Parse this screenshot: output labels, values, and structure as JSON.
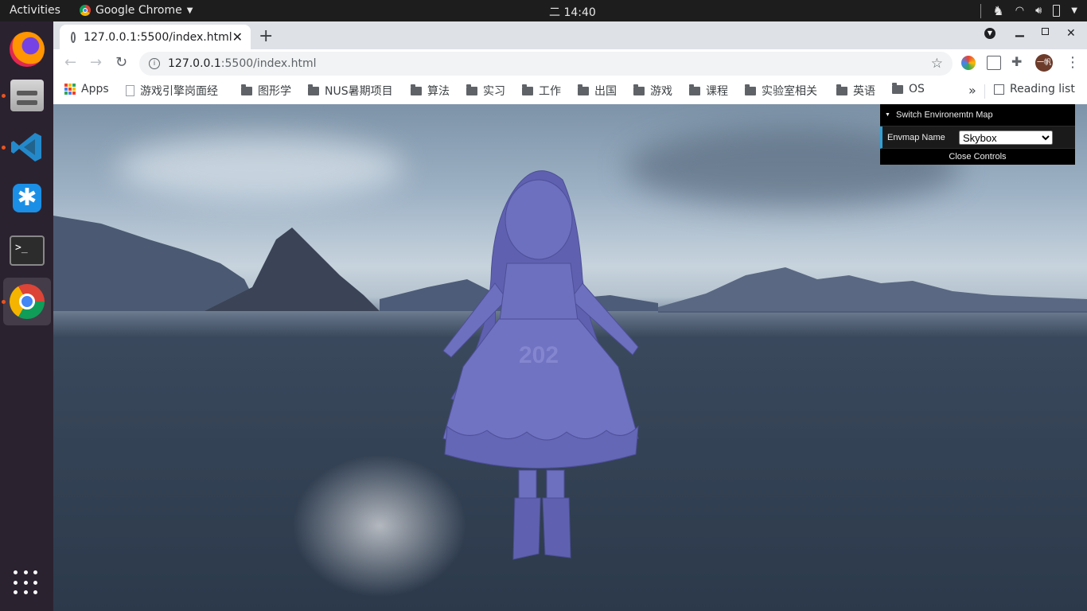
{
  "topbar": {
    "activities": "Activities",
    "app_name": "Google Chrome",
    "clock": "二 14:40"
  },
  "dock": {
    "items": [
      "firefox",
      "files",
      "vscode",
      "ticktick",
      "terminal",
      "chrome"
    ],
    "terminal_prompt": ">_"
  },
  "browser": {
    "tab_title": "127.0.0.1:5500/index.html",
    "url_host": "127.0.0.1",
    "url_rest": ":5500/index.html",
    "avatar_text": "一帆",
    "bookmarks": [
      {
        "label": "Apps",
        "type": "apps"
      },
      {
        "label": "游戏引擎岗面经",
        "type": "page"
      },
      {
        "label": "图形学",
        "type": "folder"
      },
      {
        "label": "NUS暑期项目",
        "type": "folder"
      },
      {
        "label": "算法",
        "type": "folder"
      },
      {
        "label": "实习",
        "type": "folder"
      },
      {
        "label": "工作",
        "type": "folder"
      },
      {
        "label": "出国",
        "type": "folder"
      },
      {
        "label": "游戏",
        "type": "folder"
      },
      {
        "label": "课程",
        "type": "folder"
      },
      {
        "label": "实验室相关",
        "type": "folder"
      },
      {
        "label": "英语",
        "type": "folder"
      },
      {
        "label": "OS",
        "type": "folder"
      }
    ],
    "more_bookmarks": "»",
    "reading_list": "Reading list"
  },
  "gui": {
    "folder_title": "Switch Environemtn Map",
    "envmap_label": "Envmap Name",
    "envmap_value": "Skybox",
    "close_label": "Close Controls"
  },
  "scene": {
    "model_text": "202",
    "model_color": "#6d6fbf"
  }
}
